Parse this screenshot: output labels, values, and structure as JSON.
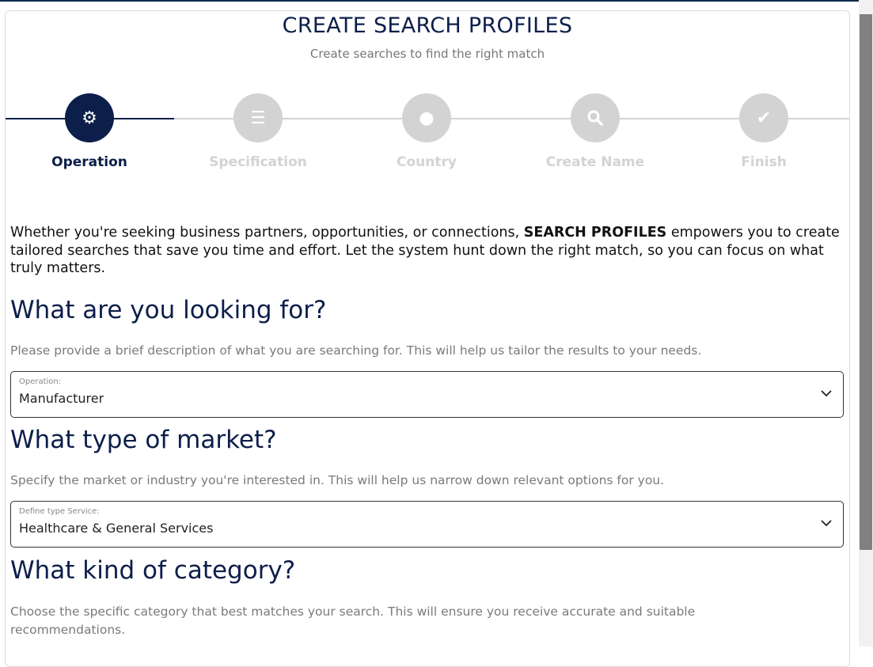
{
  "header": {
    "title": "CREATE SEARCH PROFILES",
    "subtitle": "Create searches to find the right match"
  },
  "steps": [
    {
      "label": "Operation",
      "icon": "gear-icon",
      "active": true
    },
    {
      "label": "Specification",
      "icon": "list-icon",
      "active": false
    },
    {
      "label": "Country",
      "icon": "globe-icon",
      "active": false
    },
    {
      "label": "Create Name",
      "icon": "search-icon",
      "active": false
    },
    {
      "label": "Finish",
      "icon": "check-icon",
      "active": false
    }
  ],
  "intro": {
    "before": "Whether you're seeking business partners, opportunities, or connections, ",
    "bold": "SEARCH PROFILES",
    "after": " empowers you to create tailored searches that save you time and effort. Let the system hunt down the right match, so you can focus on what truly matters."
  },
  "sections": [
    {
      "heading": "What are you looking for?",
      "description": "Please provide a brief description of what you are searching for. This will help us tailor the results to your needs.",
      "field_label": "Operation:",
      "field_value": "Manufacturer"
    },
    {
      "heading": "What type of market?",
      "description": "Specify the market or industry you're interested in. This will help us narrow down relevant options for you.",
      "field_label": "Define type Service:",
      "field_value": "Healthcare & General Services"
    },
    {
      "heading": "What kind of category?",
      "description": "Choose the specific category that best matches your search. This will ensure you receive accurate and suitable recommendations."
    }
  ],
  "colors": {
    "primary": "#0c1e4a",
    "inactive": "#d3d3d3"
  }
}
